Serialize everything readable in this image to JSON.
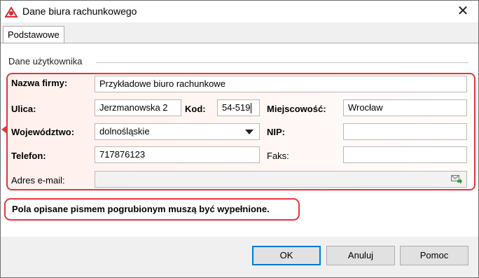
{
  "window": {
    "title": "Dane biura rachunkowego",
    "close_glyph": "✕",
    "app_icon": "app-logo-icon"
  },
  "tabs": [
    {
      "label": "Podstawowe",
      "selected": true
    }
  ],
  "group": {
    "label": "Dane użytkownika"
  },
  "form": {
    "company_label": "Nazwa firmy:",
    "company_value": "Przykładowe biuro rachunkowe",
    "street_label": "Ulica:",
    "street_value": "Jerzmanowska 2",
    "postcode_label": "Kod:",
    "postcode_value": "54-519",
    "city_label": "Miejscowość:",
    "city_value": "Wrocław",
    "voivodeship_label": "Województwo:",
    "voivodeship_value": "dolnośląskie",
    "nip_label": "NIP:",
    "nip_value": "",
    "phone_label": "Telefon:",
    "phone_value": "717876123",
    "fax_label": "Faks:",
    "fax_value": "",
    "email_label": "Adres e-mail:",
    "email_value": ""
  },
  "note": "Pola opisane pismem pogrubionym muszą być wypełnione.",
  "buttons": {
    "ok": "OK",
    "cancel": "Anuluj",
    "help": "Pomoc"
  },
  "colors": {
    "highlight": "#e0363c",
    "accent": "#0078d7"
  }
}
